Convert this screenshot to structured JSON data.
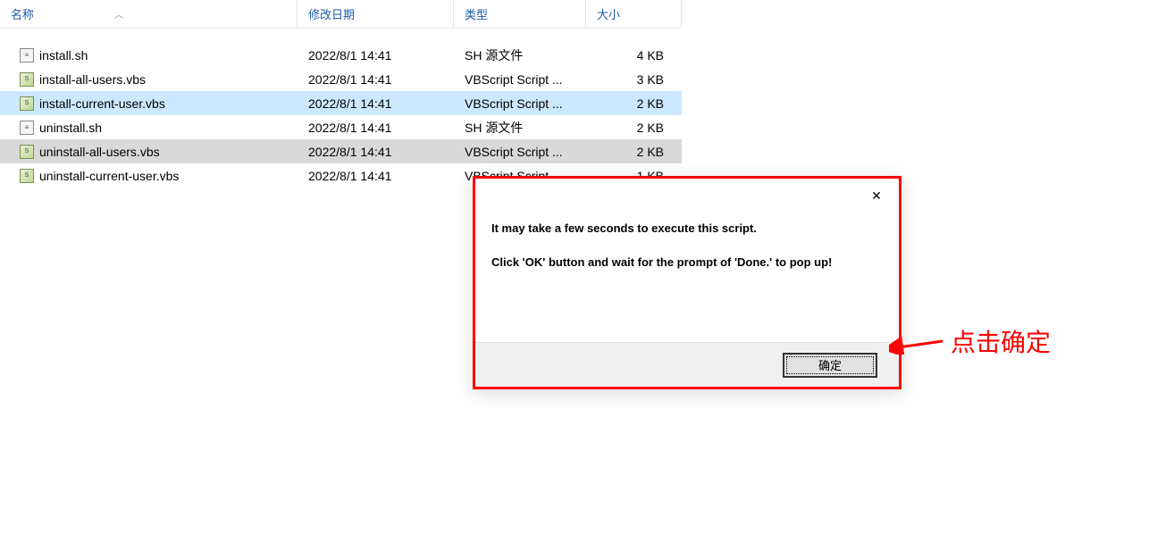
{
  "columns": {
    "name": "名称",
    "date": "修改日期",
    "type": "类型",
    "size": "大小"
  },
  "files": [
    {
      "name": "install.sh",
      "date": "2022/8/1 14:41",
      "type": "SH 源文件",
      "size": "4 KB",
      "icon": "sh",
      "state": ""
    },
    {
      "name": "install-all-users.vbs",
      "date": "2022/8/1 14:41",
      "type": "VBScript Script ...",
      "size": "3 KB",
      "icon": "vbs",
      "state": ""
    },
    {
      "name": "install-current-user.vbs",
      "date": "2022/8/1 14:41",
      "type": "VBScript Script ...",
      "size": "2 KB",
      "icon": "vbs",
      "state": "highlighted"
    },
    {
      "name": "uninstall.sh",
      "date": "2022/8/1 14:41",
      "type": "SH 源文件",
      "size": "2 KB",
      "icon": "sh",
      "state": ""
    },
    {
      "name": "uninstall-all-users.vbs",
      "date": "2022/8/1 14:41",
      "type": "VBScript Script ...",
      "size": "2 KB",
      "icon": "vbs",
      "state": "selected"
    },
    {
      "name": "uninstall-current-user.vbs",
      "date": "2022/8/1 14:41",
      "type": "VBScript Script ...",
      "size": "1 KB",
      "icon": "vbs",
      "state": ""
    }
  ],
  "dialog": {
    "line1": "It may take a few seconds to execute this script.",
    "line2": "Click 'OK' button and wait for the prompt of 'Done.' to pop up!",
    "ok_label": "确定"
  },
  "annotation": {
    "text": "点击确定"
  }
}
